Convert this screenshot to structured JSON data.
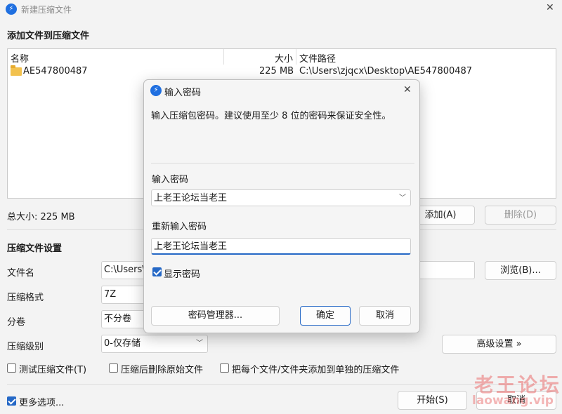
{
  "window": {
    "title": "新建压缩文件",
    "close_glyph": "✕"
  },
  "add_section": {
    "title": "添加文件到压缩文件",
    "columns": {
      "name": "名称",
      "size": "大小",
      "path": "文件路径"
    },
    "rows": [
      {
        "name": "AE547800487",
        "size": "225 MB",
        "path": "C:\\Users\\zjqcx\\Desktop\\AE547800487",
        "icon": "folder-icon"
      }
    ],
    "total_size": "总大小: 225 MB",
    "add_button": "添加(A)",
    "delete_button": "删除(D)"
  },
  "settings": {
    "title": "压缩文件设置",
    "filename_label": "文件名",
    "filename_value": "C:\\Users\\",
    "browse_button": "浏览(B)...",
    "format_label": "压缩格式",
    "format_value": "7Z",
    "volume_label": "分卷",
    "volume_value": "不分卷",
    "level_label": "压缩级别",
    "level_value": "0-仅存储",
    "advanced_button": "高级设置 »",
    "options": [
      {
        "label": "测试压缩文件(T)",
        "checked": false
      },
      {
        "label": "压缩后删除原始文件",
        "checked": false
      },
      {
        "label": "把每个文件/文件夹添加到单独的压缩文件",
        "checked": false
      }
    ]
  },
  "footer": {
    "more_options": "更多选项...",
    "more_options_checked": true,
    "start_button": "开始(S)",
    "cancel_button": "取消"
  },
  "dialog": {
    "title": "输入密码",
    "close_glyph": "✕",
    "description": "输入压缩包密码。建议使用至少 8 位的密码来保证安全性。",
    "password_label": "输入密码",
    "password_value": "上老王论坛当老王",
    "reenter_label": "重新输入密码",
    "reenter_value": "上老王论坛当老王",
    "show_password_label": "显示密码",
    "show_password_checked": true,
    "manager_button": "密码管理器...",
    "ok_button": "确定",
    "cancel_button": "取消"
  },
  "watermark": {
    "line1": "老王论坛",
    "line2": "laowang.vip"
  },
  "colors": {
    "accent": "#2568c6",
    "watermark": "#ea6e6e"
  }
}
